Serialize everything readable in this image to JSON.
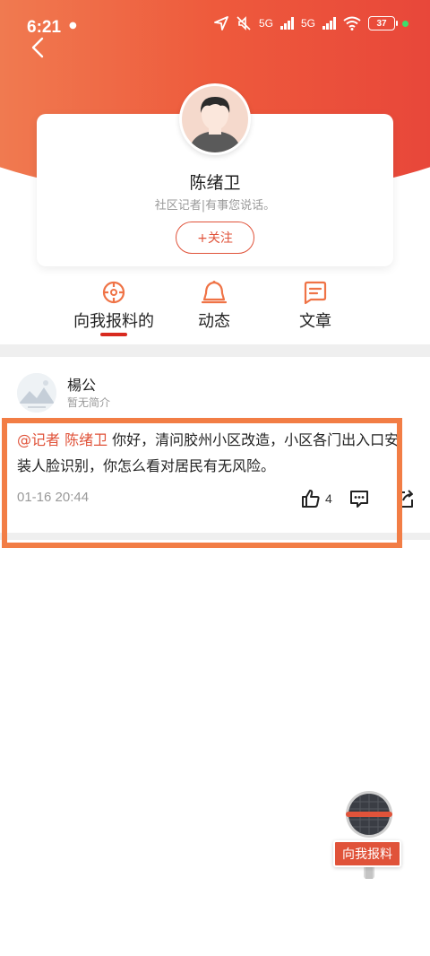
{
  "status": {
    "time": "6:21",
    "battery": "37",
    "net1": "5G",
    "net2": "5G"
  },
  "profile": {
    "name": "陈绪卫",
    "bio": "社区记者|有事您说话。",
    "follow_label": "+关注"
  },
  "tabs": [
    {
      "label": "向我报料的",
      "icon": "crosshair-icon",
      "active": true
    },
    {
      "label": "动态",
      "icon": "bell-icon",
      "active": false
    },
    {
      "label": "文章",
      "icon": "article-icon",
      "active": false
    }
  ],
  "post": {
    "user": "楊公",
    "user_sub": "暂无简介",
    "mention": "@记者 陈绪卫",
    "text": " 你好，清问胶州小区改造，小区各门出入口安装人脸识别，你怎么看对居民有无风险。",
    "time": "01-16 20:44",
    "likes": "4"
  },
  "float_button": {
    "label": "向我报料"
  },
  "colors": {
    "accent": "#e0533a",
    "header_start": "#f07a50",
    "header_end": "#e8473a",
    "highlight": "#f27d45"
  }
}
